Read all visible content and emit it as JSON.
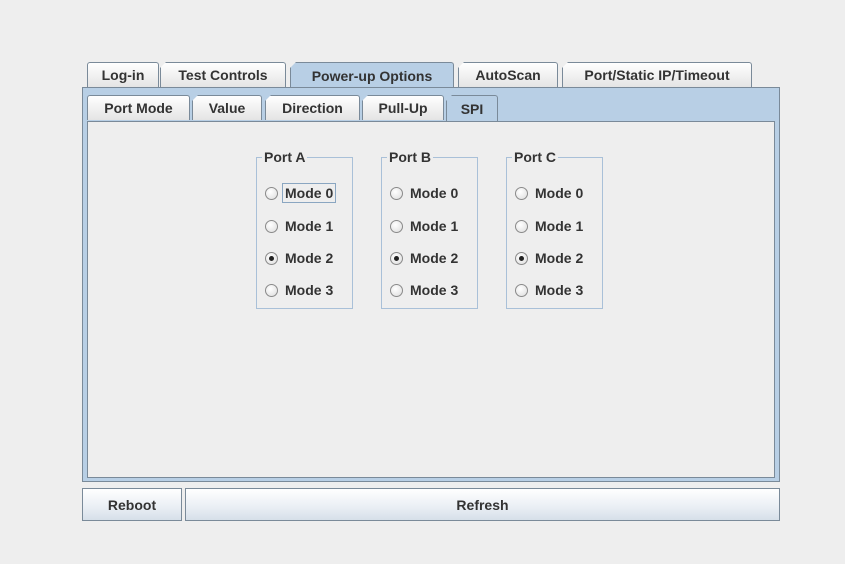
{
  "tabs": [
    {
      "label": "Log-in"
    },
    {
      "label": "Test Controls"
    },
    {
      "label": "Power-up Options"
    },
    {
      "label": "AutoScan"
    },
    {
      "label": "Port/Static IP/Timeout"
    }
  ],
  "selected_tab": "Power-up Options",
  "subtabs": [
    {
      "label": "Port Mode"
    },
    {
      "label": "Value"
    },
    {
      "label": "Direction"
    },
    {
      "label": "Pull-Up"
    },
    {
      "label": "SPI"
    }
  ],
  "selected_subtab": "SPI",
  "ports": [
    {
      "title": "Port A",
      "modes": [
        "Mode 0",
        "Mode 1",
        "Mode 2",
        "Mode 3"
      ],
      "selected": "Mode 2"
    },
    {
      "title": "Port B",
      "modes": [
        "Mode 0",
        "Mode 1",
        "Mode 2",
        "Mode 3"
      ],
      "selected": "Mode 2"
    },
    {
      "title": "Port C",
      "modes": [
        "Mode 0",
        "Mode 1",
        "Mode 2",
        "Mode 3"
      ],
      "selected": "Mode 2"
    }
  ],
  "buttons": {
    "reboot": "Reboot",
    "refresh": "Refresh"
  },
  "colors": {
    "selected_tab": "#b8cfe5",
    "border": "#7a8a99",
    "background": "#eeeeee"
  }
}
